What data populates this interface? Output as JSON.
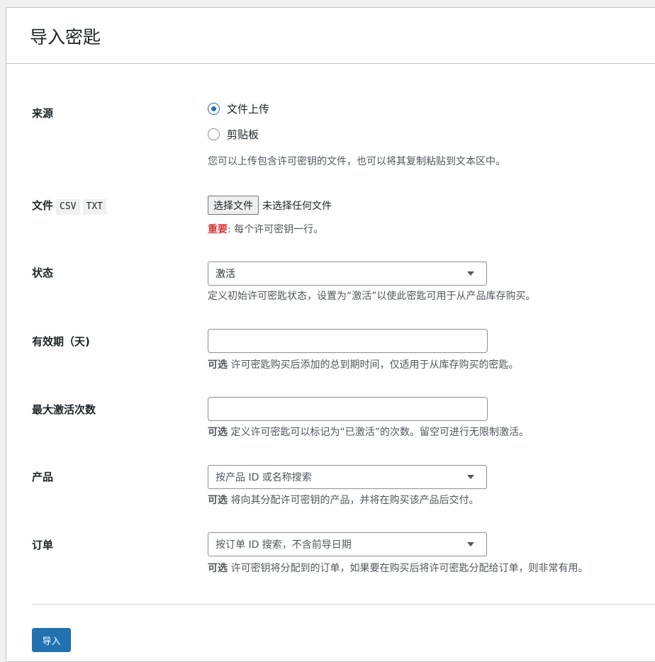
{
  "page": {
    "title": "导入密匙"
  },
  "source": {
    "label": "来源",
    "options": [
      {
        "label": "文件上传",
        "checked": true
      },
      {
        "label": "剪贴板",
        "checked": false
      }
    ],
    "description": "您可以上传包含许可密钥的文件，也可以将其复制粘贴到文本区中。"
  },
  "file": {
    "label": "文件",
    "badges": [
      "CSV",
      "TXT"
    ],
    "button_label": "选择文件",
    "status": "未选择任何文件",
    "note_important": "重要",
    "note_text": ": 每个许可密钥一行。"
  },
  "status": {
    "label": "状态",
    "selected": "激活",
    "description": "定义初始许可密匙状态，设置为“激活”以使此密匙可用于从产品库存购买。"
  },
  "validity": {
    "label": "有效期（天)",
    "value": "",
    "optional": "可选",
    "description": " 许可密匙购买后添加的总到期时间，仅适用于从库存购买的密匙。"
  },
  "max_activations": {
    "label": "最大激活次数",
    "value": "",
    "optional": "可选",
    "description": " 定义许可密匙可以标记为“已激活”的次数。留空可进行无限制激活。"
  },
  "product": {
    "label": "产品",
    "placeholder": "按产品 ID 或名称搜索",
    "optional": "可选",
    "description": " 将向其分配许可密钥的产品，并将在购买该产品后交付。"
  },
  "order": {
    "label": "订单",
    "placeholder": "按订单 ID 搜索，不含前导日期",
    "optional": "可选",
    "description": " 许可密钥将分配到的订单，如果要在购买后将许可密匙分配给订单，则非常有用。"
  },
  "actions": {
    "import_label": "导入"
  },
  "colors": {
    "primary": "#2271b1",
    "important": "#d63638"
  }
}
